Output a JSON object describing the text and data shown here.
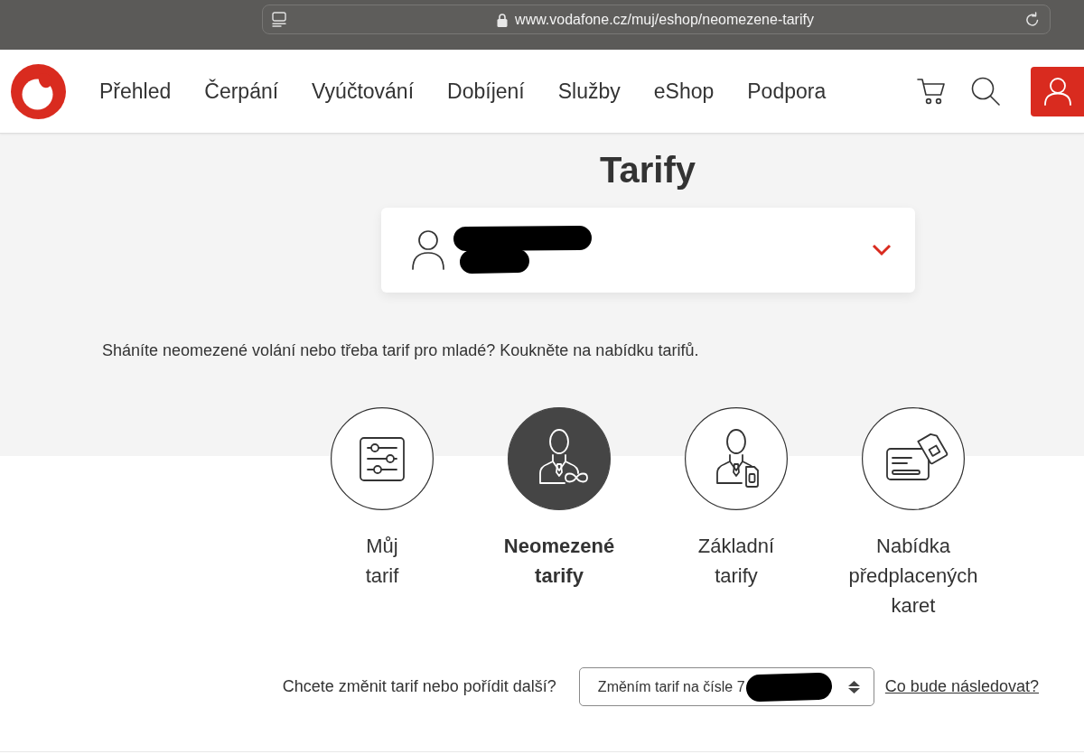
{
  "browser": {
    "url": "www.vodafone.cz/muj/eshop/neomezene-tarify"
  },
  "header": {
    "nav_items": [
      "Přehled",
      "Čerpání",
      "Vyúčtování",
      "Dobíjení",
      "Služby",
      "eShop",
      "Podpora"
    ]
  },
  "page": {
    "title": "Tarify",
    "intro": "Sháníte neomezené volání nebo třeba tarif pro mladé? Koukněte na nabídku tarifů.",
    "tariff_types": [
      {
        "kind": "sliders",
        "label": "Můj tarif",
        "selected": false
      },
      {
        "kind": "unlimited",
        "label": "Neomezené tarify",
        "selected": true
      },
      {
        "kind": "sim",
        "label": "Základní tarify",
        "selected": false
      },
      {
        "kind": "prepaid",
        "label": "Nabídka předplacených karet",
        "selected": false
      }
    ],
    "change": {
      "question": "Chcete změnit tarif nebo pořídit další?",
      "select_value": "Změním tarif na čísle 7",
      "link": "Co bude následovat?"
    }
  }
}
